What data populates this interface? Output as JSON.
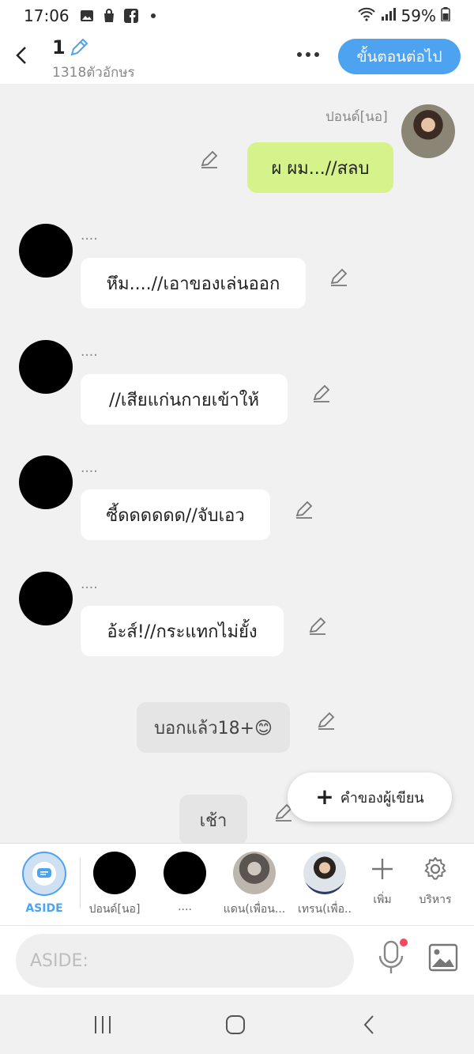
{
  "status": {
    "time": "17:06",
    "battery": "59%"
  },
  "header": {
    "title": "1",
    "char_count": "1318ตัวอักษร",
    "next_label": "ขั้นตอนต่อไป"
  },
  "messages": [
    {
      "sender": "ปอนด์[นอ]",
      "text": "ผ ผม...//สลบ"
    },
    {
      "sender": "....",
      "text": "หึม....//เอาของเล่นออก"
    },
    {
      "sender": "....",
      "text": "//เสียแก่นกายเข้าให้"
    },
    {
      "sender": "....",
      "text": "ซี้ดดดดดด//จับเอว"
    },
    {
      "sender": "....",
      "text": "อ้ะส์!//กระแทกไม่ยั้ง"
    },
    {
      "text": "บอกแล้ว18+😊"
    },
    {
      "text": "เช้า"
    }
  ],
  "fab": {
    "label": "คำของผู้เขียน"
  },
  "characters": [
    {
      "label": "ASIDE"
    },
    {
      "label": "ปอนด์[นอ]"
    },
    {
      "label": "...."
    },
    {
      "label": "แดน(เพื่อน..."
    },
    {
      "label": "เทรน(เพื่อ.."
    }
  ],
  "tools": {
    "add_label": "เพิ่ม",
    "manage_label": "บริหาร"
  },
  "input": {
    "placeholder": "ASIDE:"
  },
  "colors": {
    "accent": "#4ea3f0",
    "my_bubble": "#d6f38b",
    "narration_bubble": "#e5e5e5"
  }
}
